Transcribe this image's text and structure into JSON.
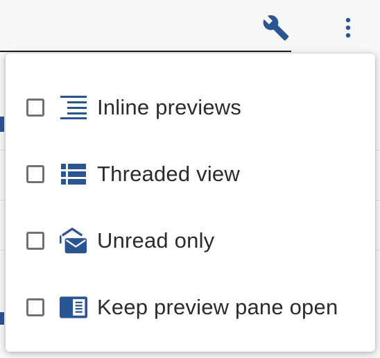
{
  "toolbar": {
    "wrench_icon": "wrench-icon",
    "more_icon": "more-vertical-icon"
  },
  "colors": {
    "accent": "#2a5593",
    "checkbox_border": "#707070",
    "text": "#2b2b2b"
  },
  "menu": {
    "items": [
      {
        "label": "Inline previews",
        "icon": "inline-previews-icon",
        "checked": false
      },
      {
        "label": "Threaded view",
        "icon": "threaded-view-icon",
        "checked": false
      },
      {
        "label": "Unread only",
        "icon": "unread-mail-icon",
        "checked": false
      },
      {
        "label": "Keep preview pane open",
        "icon": "preview-pane-icon",
        "checked": false
      }
    ]
  }
}
